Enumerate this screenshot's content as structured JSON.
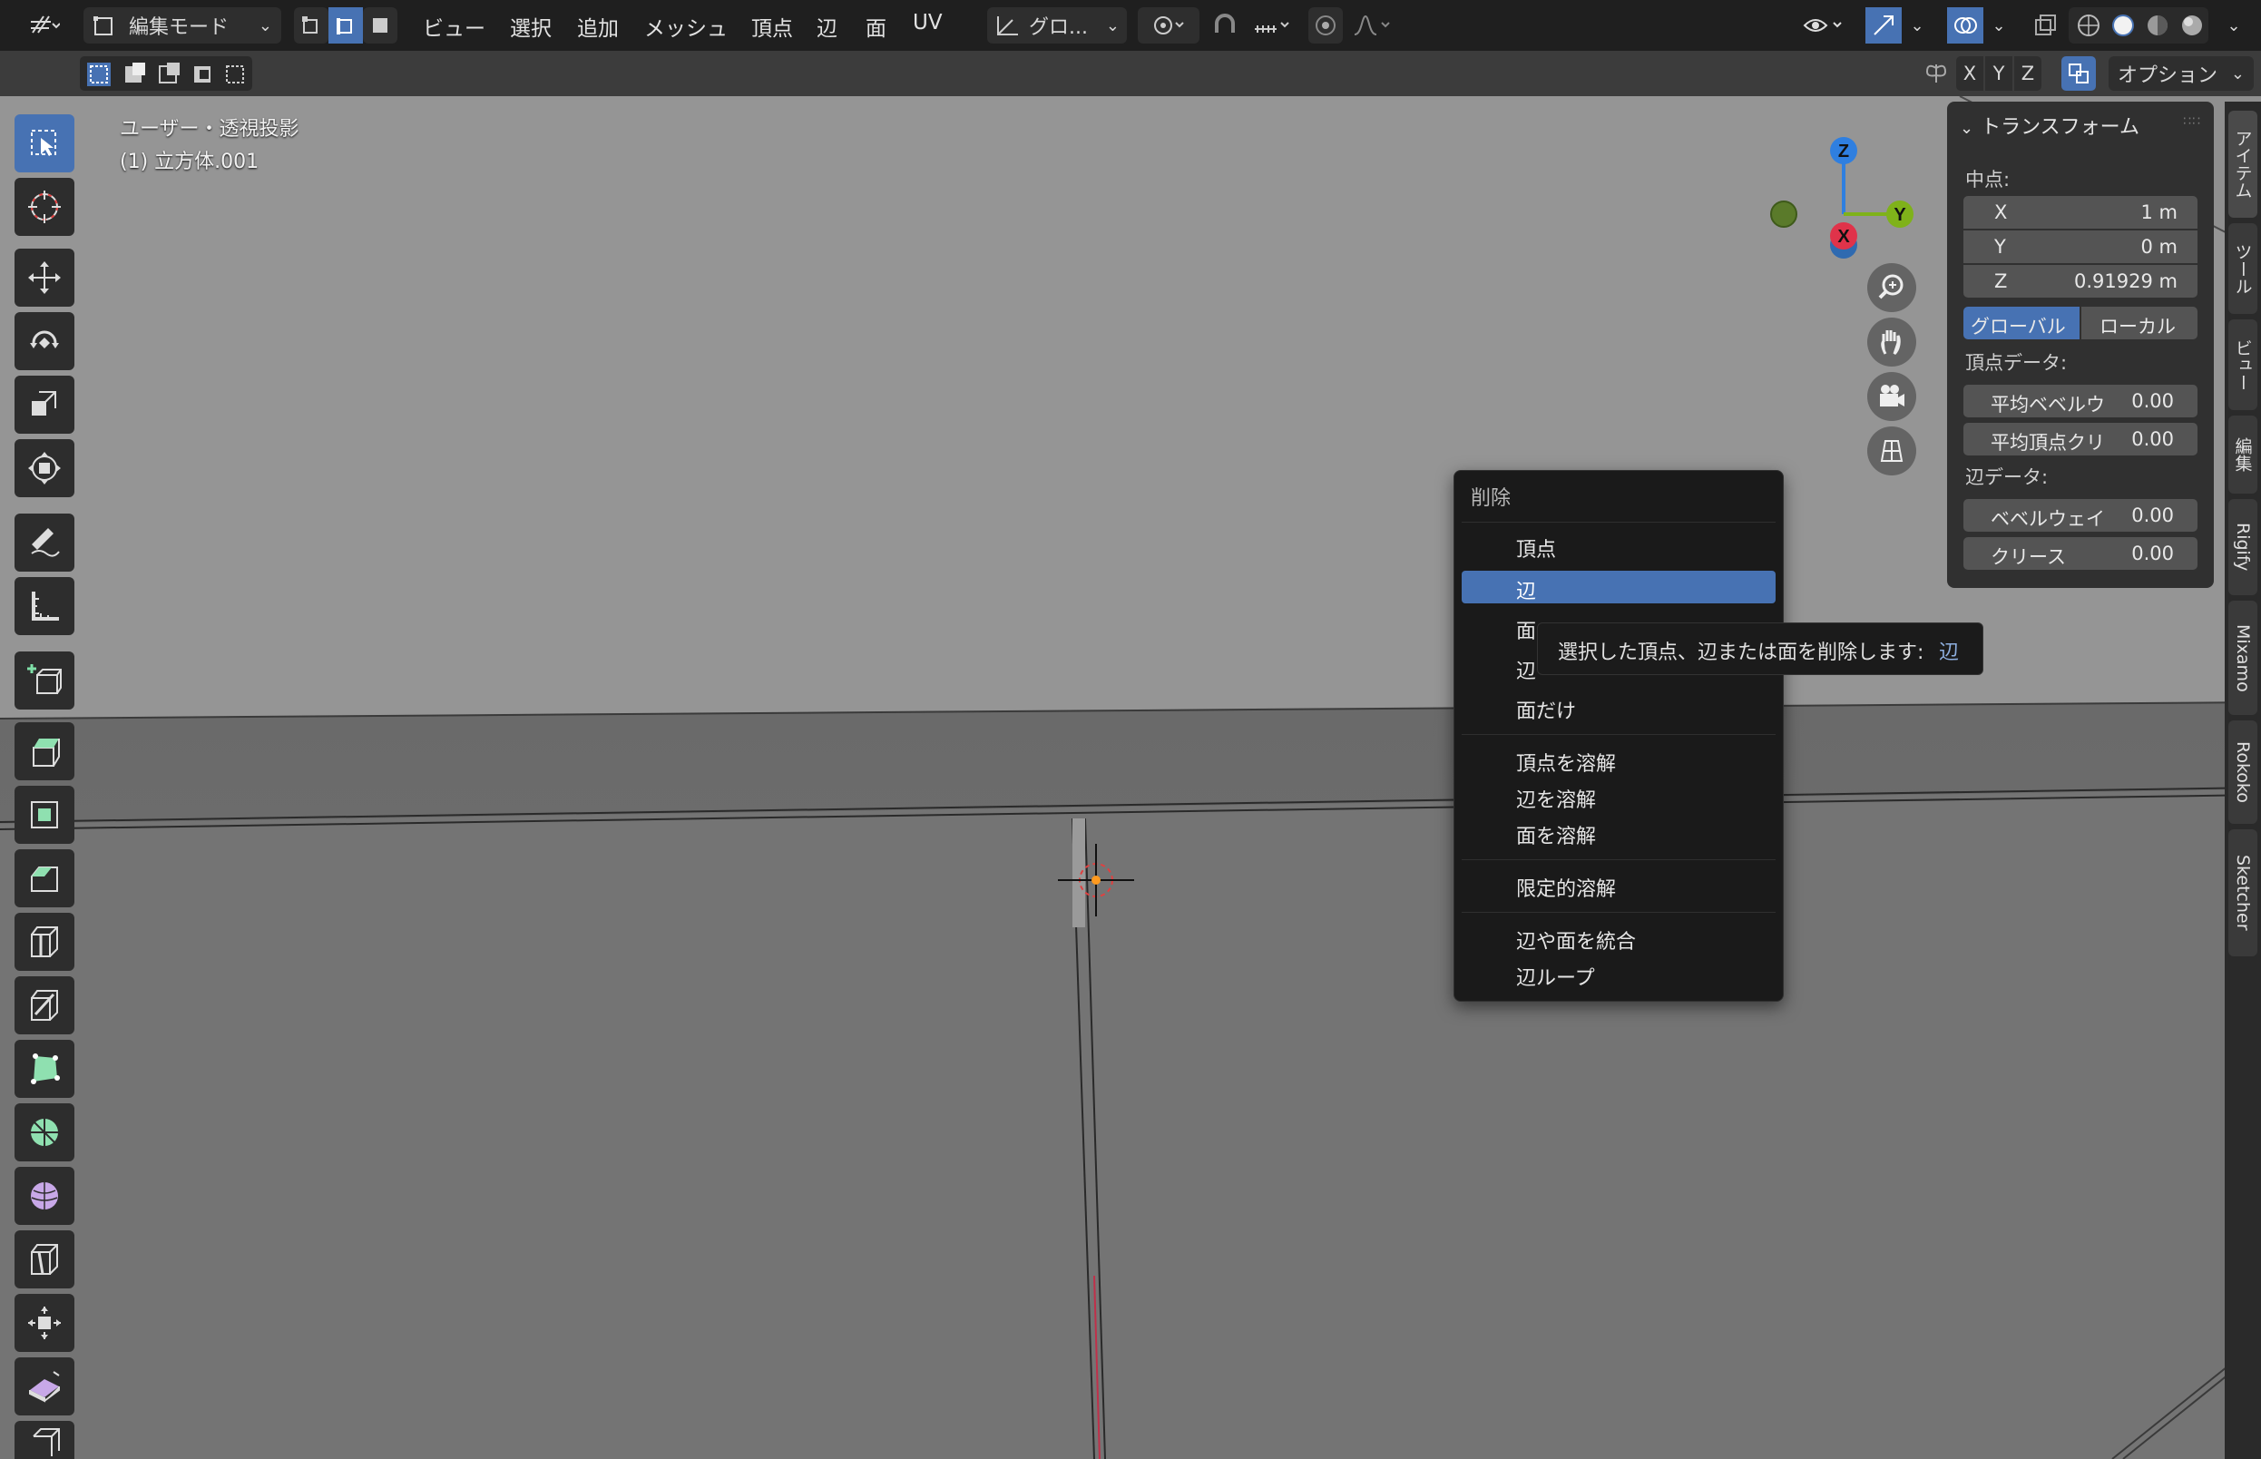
{
  "topbar": {
    "mode_label": "編集モード",
    "menu": [
      "ビュー",
      "選択",
      "追加",
      "メッシュ",
      "頂点",
      "辺",
      "面",
      "UV"
    ],
    "transform_orientation": "グロ...",
    "axis_labels": [
      "X",
      "Y",
      "Z"
    ],
    "options_label": "オプション"
  },
  "viewport": {
    "view_name": "ユーザー・透視投影",
    "object_name": "(1) 立方体.001",
    "gizmo": {
      "x": "X",
      "y": "Y",
      "z": "Z"
    }
  },
  "npanel": {
    "header": "トランスフォーム",
    "median_label": "中点:",
    "fields": [
      {
        "label": "X",
        "value": "1 m"
      },
      {
        "label": "Y",
        "value": "0 m"
      },
      {
        "label": "Z",
        "value": "0.91929 m"
      }
    ],
    "global_label": "グローバル",
    "local_label": "ローカル",
    "vertex_data_label": "頂点データ:",
    "vertex_fields": [
      {
        "label": "平均ベベルウ",
        "value": "0.00"
      },
      {
        "label": "平均頂点クリ",
        "value": "0.00"
      }
    ],
    "edge_data_label": "辺データ:",
    "edge_fields": [
      {
        "label": "ベベルウェイ",
        "value": "0.00"
      },
      {
        "label": "クリース",
        "value": "0.00"
      }
    ]
  },
  "sidetabs": [
    "アイテム",
    "ツール",
    "ビュー",
    "編集",
    "Rigify",
    "Mixamo",
    "Rokoko",
    "Sketcher"
  ],
  "delete_menu": {
    "title": "削除",
    "items": [
      "頂点",
      "辺",
      "面",
      "辺",
      "面だけ",
      "頂点を溶解",
      "辺を溶解",
      "面を溶解",
      "限定的溶解",
      "辺や面を統合",
      "辺ループ"
    ],
    "highlighted": "辺"
  },
  "tooltip": {
    "text": "選択した頂点、辺または面を削除します:",
    "value": "辺"
  },
  "colors": {
    "accent": "#4772b3",
    "axis_x": "#e0334a",
    "axis_y": "#7fb21a",
    "axis_z": "#2f7fe0"
  }
}
